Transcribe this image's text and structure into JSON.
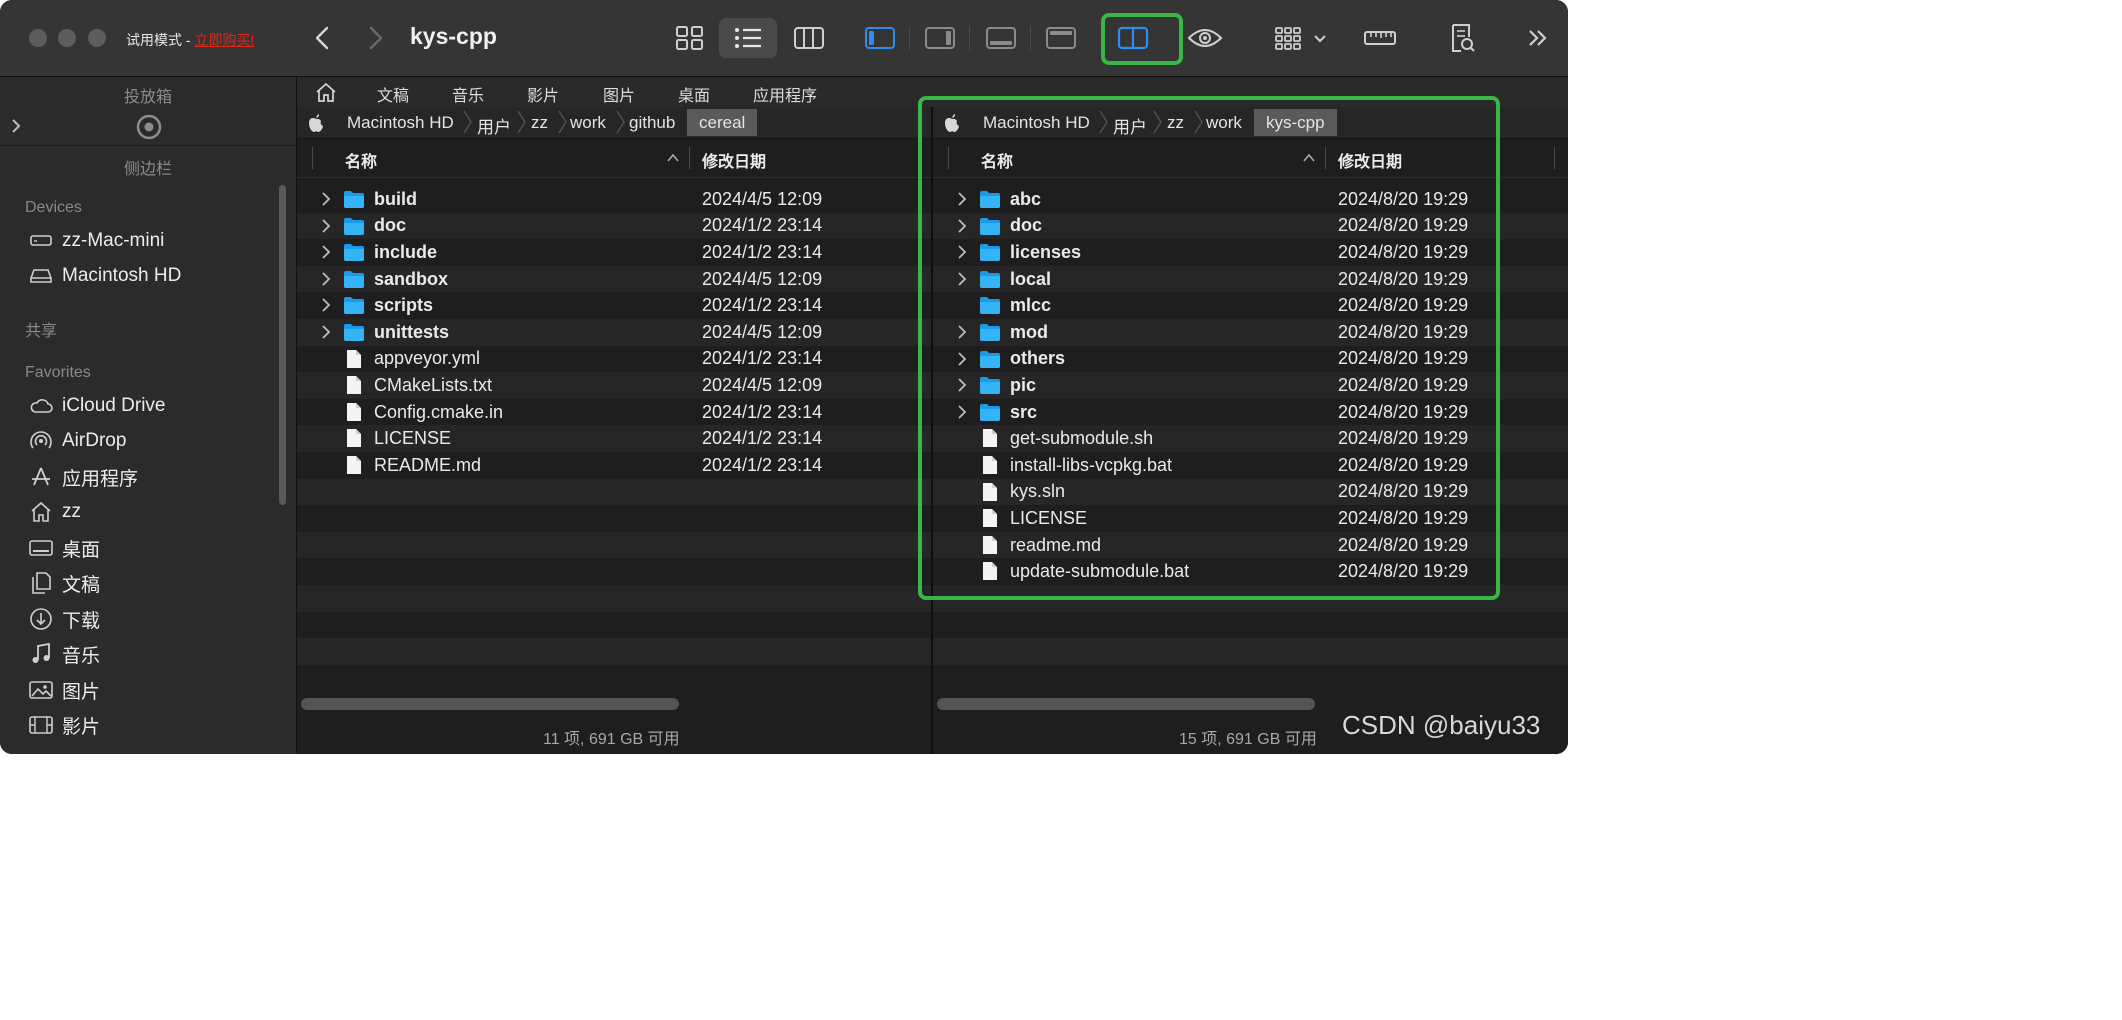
{
  "window": {
    "trial_label": "试用模式 - ",
    "buy_label": "立即购买!",
    "title": "kys-cpp"
  },
  "toolbar": {
    "icons": [
      "grid-view-icon",
      "list-view-icon",
      "column-view-icon",
      "sidebar-left-icon",
      "sidebar-right-icon",
      "bottom-panel-icon",
      "top-panel-icon",
      "dual-pane-icon",
      "eye-icon",
      "group-icon",
      "ruler-icon",
      "info-doc-icon",
      "more-chevron-icon"
    ],
    "active_view": "list",
    "highlight_color": "#39b54a"
  },
  "sidebar": {
    "shelf_label": "投放箱",
    "sidebar_label": "侧边栏",
    "sections": {
      "devices": "Devices",
      "shared": "共享",
      "favorites": "Favorites"
    },
    "devices": [
      {
        "label": "zz-Mac-mini",
        "icon": "display-icon"
      },
      {
        "label": "Macintosh HD",
        "icon": "harddisk-icon"
      }
    ],
    "favorites": [
      {
        "label": "iCloud Drive",
        "icon": "cloud-icon"
      },
      {
        "label": "AirDrop",
        "icon": "airdrop-icon"
      },
      {
        "label": "应用程序",
        "icon": "apps-icon"
      },
      {
        "label": "zz",
        "icon": "home-icon"
      },
      {
        "label": "桌面",
        "icon": "desktop-icon"
      },
      {
        "label": "文稿",
        "icon": "document-icon"
      },
      {
        "label": "下载",
        "icon": "download-icon"
      },
      {
        "label": "音乐",
        "icon": "music-icon"
      },
      {
        "label": "图片",
        "icon": "photo-icon"
      },
      {
        "label": "影片",
        "icon": "film-icon"
      }
    ]
  },
  "favbar": {
    "items": [
      "文稿",
      "音乐",
      "影片",
      "图片",
      "桌面",
      "应用程序"
    ]
  },
  "left_pane": {
    "breadcrumbs": [
      "Macintosh HD",
      "用户",
      "zz",
      "work",
      "github",
      "cereal"
    ],
    "col_name": "名称",
    "col_date": "修改日期",
    "rows": [
      {
        "name": "build",
        "date": "2024/4/5 12:09",
        "folder": true
      },
      {
        "name": "doc",
        "date": "2024/1/2 23:14",
        "folder": true
      },
      {
        "name": "include",
        "date": "2024/1/2 23:14",
        "folder": true
      },
      {
        "name": "sandbox",
        "date": "2024/4/5 12:09",
        "folder": true
      },
      {
        "name": "scripts",
        "date": "2024/1/2 23:14",
        "folder": true
      },
      {
        "name": "unittests",
        "date": "2024/4/5 12:09",
        "folder": true
      },
      {
        "name": "appveyor.yml",
        "date": "2024/1/2 23:14",
        "folder": false
      },
      {
        "name": "CMakeLists.txt",
        "date": "2024/4/5 12:09",
        "folder": false
      },
      {
        "name": "Config.cmake.in",
        "date": "2024/1/2 23:14",
        "folder": false
      },
      {
        "name": "LICENSE",
        "date": "2024/1/2 23:14",
        "folder": false
      },
      {
        "name": "README.md",
        "date": "2024/1/2 23:14",
        "folder": false
      }
    ],
    "status": "11 项, 691 GB 可用"
  },
  "right_pane": {
    "breadcrumbs": [
      "Macintosh HD",
      "用户",
      "zz",
      "work",
      "kys-cpp"
    ],
    "col_name": "名称",
    "col_date": "修改日期",
    "rows": [
      {
        "name": "abc",
        "date": "2024/8/20 19:29",
        "folder": true,
        "expandable": true
      },
      {
        "name": "doc",
        "date": "2024/8/20 19:29",
        "folder": true,
        "expandable": true
      },
      {
        "name": "licenses",
        "date": "2024/8/20 19:29",
        "folder": true,
        "expandable": true
      },
      {
        "name": "local",
        "date": "2024/8/20 19:29",
        "folder": true,
        "expandable": true
      },
      {
        "name": "mlcc",
        "date": "2024/8/20 19:29",
        "folder": true,
        "expandable": false
      },
      {
        "name": "mod",
        "date": "2024/8/20 19:29",
        "folder": true,
        "expandable": true
      },
      {
        "name": "others",
        "date": "2024/8/20 19:29",
        "folder": true,
        "expandable": true
      },
      {
        "name": "pic",
        "date": "2024/8/20 19:29",
        "folder": true,
        "expandable": true
      },
      {
        "name": "src",
        "date": "2024/8/20 19:29",
        "folder": true,
        "expandable": true
      },
      {
        "name": "get-submodule.sh",
        "date": "2024/8/20 19:29",
        "folder": false
      },
      {
        "name": "install-libs-vcpkg.bat",
        "date": "2024/8/20 19:29",
        "folder": false
      },
      {
        "name": "kys.sln",
        "date": "2024/8/20 19:29",
        "folder": false
      },
      {
        "name": "LICENSE",
        "date": "2024/8/20 19:29",
        "folder": false
      },
      {
        "name": "readme.md",
        "date": "2024/8/20 19:29",
        "folder": false
      },
      {
        "name": "update-submodule.bat",
        "date": "2024/8/20 19:29",
        "folder": false
      }
    ],
    "status": "15 项, 691 GB 可用"
  },
  "watermark": "CSDN @baiyu33"
}
